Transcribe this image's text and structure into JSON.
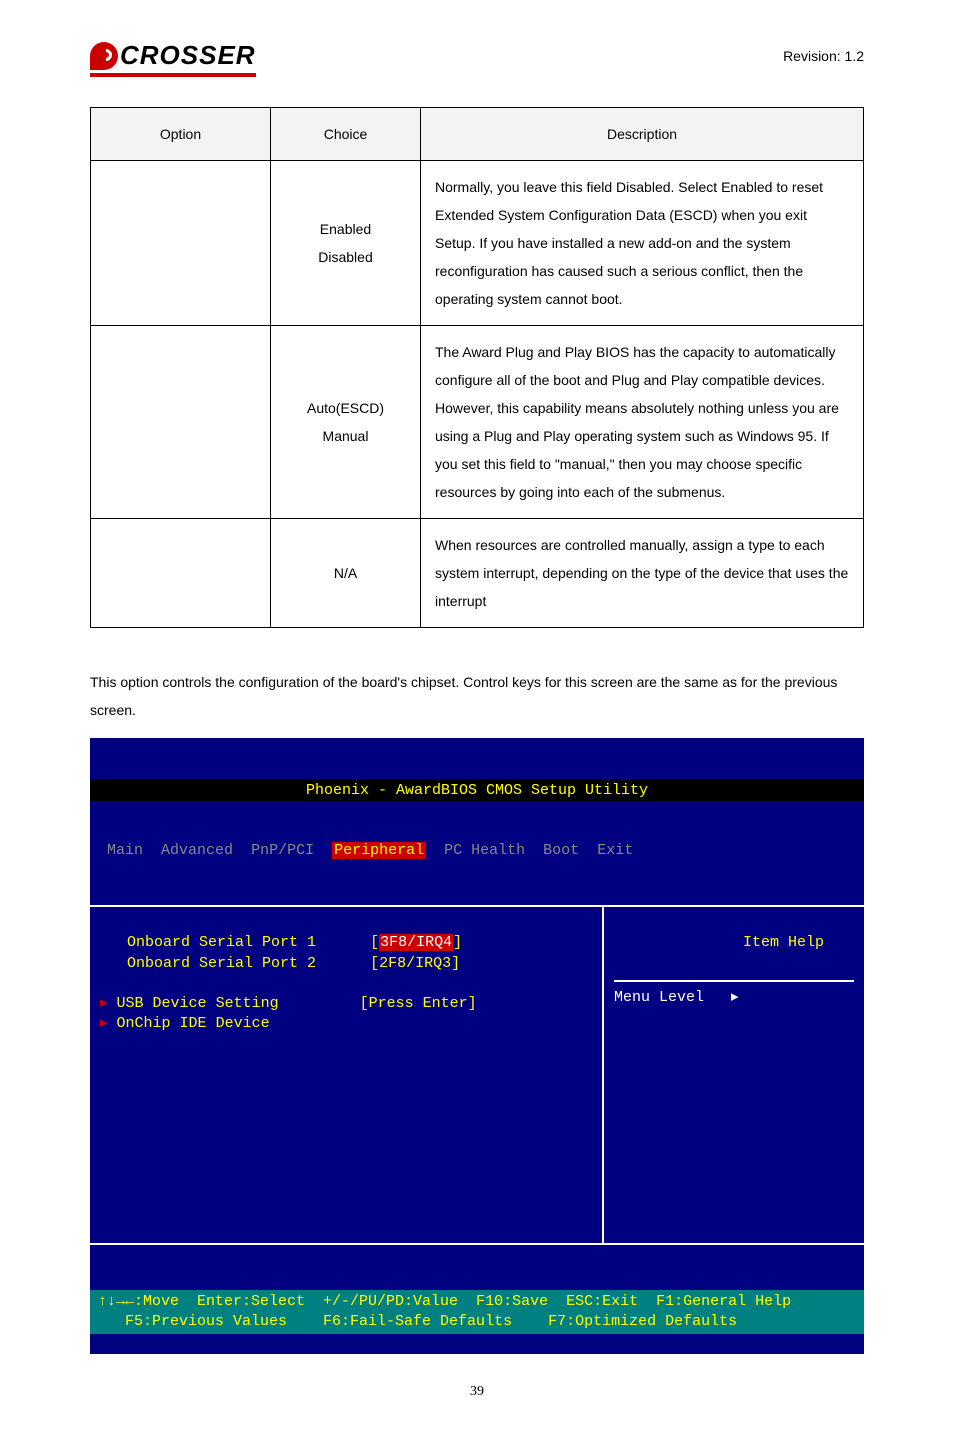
{
  "header": {
    "logo_text": "CROSSER",
    "revision": "Revision: 1.2"
  },
  "table": {
    "headers": {
      "option": "Option",
      "choice": "Choice",
      "description": "Description"
    },
    "rows": [
      {
        "option": "",
        "choice": "Enabled\nDisabled",
        "description": "Normally, you leave this field Disabled. Select Enabled to reset Extended System Configuration Data (ESCD) when you exit Setup. If you have installed a new add-on and the system reconfiguration has caused such a serious conflict, then the operating system cannot boot."
      },
      {
        "option": "",
        "choice": "Auto(ESCD)\nManual",
        "description": "The Award Plug and Play BIOS has the capacity to automatically configure all of the boot and Plug and Play compatible devices. However, this capability means absolutely nothing unless you are using a Plug and Play operating system such as Windows 95. If you set this field to \"manual,\" then you may choose specific resources by going into each of the submenus."
      },
      {
        "option": "",
        "choice": "N/A",
        "description": "When resources are controlled manually, assign a type to each system interrupt, depending on the type of the device that uses the interrupt"
      }
    ]
  },
  "paragraph": "This option controls the configuration of the board's chipset. Control keys for this screen are the same as for the previous screen.",
  "bios": {
    "title": "Phoenix - AwardBIOS CMOS Setup Utility",
    "menu": {
      "items": [
        "Main",
        "Advanced",
        "PnP/PCI",
        "Peripheral",
        "PC Health",
        "Boot",
        "Exit"
      ],
      "active": "Peripheral"
    },
    "left": {
      "line1_label": "Onboard Serial Port 1",
      "line1_value": "3F8/IRQ4",
      "line2_label": "Onboard Serial Port 2",
      "line2_value": "[2F8/IRQ3]",
      "line3_label": "USB Device Setting",
      "line3_value": "[Press Enter]",
      "line4_label": "OnChip IDE Device"
    },
    "right": {
      "help": "Item Help",
      "menu_level": "Menu Level   ▸"
    },
    "footer_line1": "↑↓→←:Move  Enter:Select  +/-/PU/PD:Value  F10:Save  ESC:Exit  F1:General Help",
    "footer_line2": "   F5:Previous Values    F6:Fail-Safe Defaults    F7:Optimized Defaults"
  },
  "page_number": "39"
}
